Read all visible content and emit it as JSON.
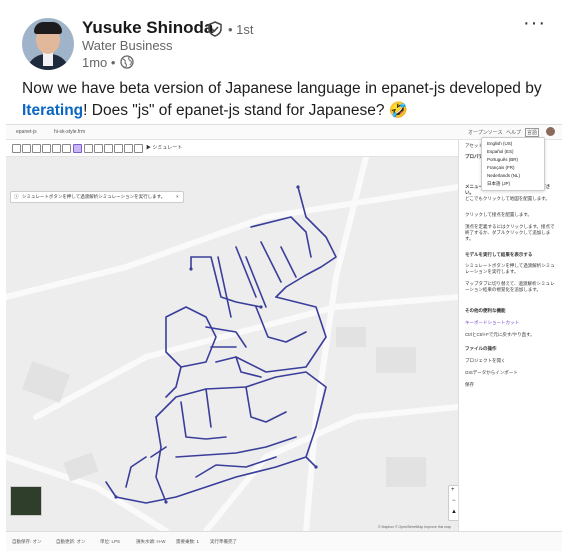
{
  "author": {
    "name": "Yusuke Shinoda",
    "degree": "• 1st",
    "headline": "Water Business",
    "time": "1mo •"
  },
  "post": {
    "text_before": "Now we have beta version of Japanese language in epanet-js developed by ",
    "link": "Iterating",
    "text_after": "! Does \"js\" of epanet-js stand for Japanese? 🤣",
    "more_label": "···"
  },
  "app": {
    "title": "epanet-js",
    "file_name": "hi-sk-style.frm",
    "simulate_label": "シミュレート",
    "banner": "シミュレートボタンを押して過渡解析シミュレーションを実行します。",
    "open_source": "オープンソース",
    "help": "ヘルプ",
    "lang_button": "言語",
    "languages": [
      "English (US)",
      "Español (ES)",
      "Português (BR)",
      "Français (FR)",
      "Nederlands (NL)",
      "日本語 (JP)"
    ],
    "panel": {
      "tab": "アセット",
      "section1": "プロパティ",
      "hint_title": "メニューから編集ツールを選択してください。",
      "hint1": "どこでもクリックして地図を配置します。",
      "hint2": "クリックして接点を配置します。",
      "hint3": "頂点を定義するにはクリックします。接点で終了するか、ダブルクリックして追加します。",
      "section2": "モデルを実行して結果を表示する",
      "hint4": "シミュレートボタンを押して過渡解析シミュレーションを実行します。",
      "hint5": "マップタブに切り替えて、過渡解析シミュレーション結果の視覚化を追加します。",
      "section3": "その他の便利な機能",
      "shortcut": "キーボードショートカット",
      "hint6": "CtrlとCtrl+Fで元に戻す/やり直す。",
      "section4": "ファイルの操作",
      "action1": "プロジェクトを開く",
      "action2": "GISデータからインポート",
      "action3": "保存"
    },
    "status": [
      "自動保存: オン",
      "自動更新: オン",
      "単位: LPS",
      "損失水頭: H-W",
      "需要乗数: 1",
      "実行準備完了"
    ],
    "attribution": "© Mapbox © OpenStreetMap Improve this map"
  },
  "colors": {
    "link": "#0a66c2",
    "network": "#3a3e9a",
    "map_bg": "#ededed"
  }
}
